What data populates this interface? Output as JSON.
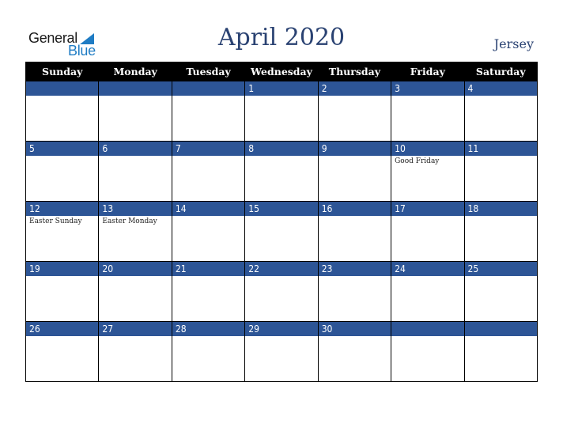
{
  "logo": {
    "general": "General",
    "blue": "Blue"
  },
  "header": {
    "title": "April 2020",
    "region": "Jersey"
  },
  "colors": {
    "accent": "#2d5596",
    "header_bg": "#000000",
    "title": "#2a4272",
    "logo_blue": "#1f7cc4"
  },
  "weekdays": [
    "Sunday",
    "Monday",
    "Tuesday",
    "Wednesday",
    "Thursday",
    "Friday",
    "Saturday"
  ],
  "weeks": [
    [
      {
        "day": "",
        "event": ""
      },
      {
        "day": "",
        "event": ""
      },
      {
        "day": "",
        "event": ""
      },
      {
        "day": "1",
        "event": ""
      },
      {
        "day": "2",
        "event": ""
      },
      {
        "day": "3",
        "event": ""
      },
      {
        "day": "4",
        "event": ""
      }
    ],
    [
      {
        "day": "5",
        "event": ""
      },
      {
        "day": "6",
        "event": ""
      },
      {
        "day": "7",
        "event": ""
      },
      {
        "day": "8",
        "event": ""
      },
      {
        "day": "9",
        "event": ""
      },
      {
        "day": "10",
        "event": "Good Friday"
      },
      {
        "day": "11",
        "event": ""
      }
    ],
    [
      {
        "day": "12",
        "event": "Easter Sunday"
      },
      {
        "day": "13",
        "event": "Easter Monday"
      },
      {
        "day": "14",
        "event": ""
      },
      {
        "day": "15",
        "event": ""
      },
      {
        "day": "16",
        "event": ""
      },
      {
        "day": "17",
        "event": ""
      },
      {
        "day": "18",
        "event": ""
      }
    ],
    [
      {
        "day": "19",
        "event": ""
      },
      {
        "day": "20",
        "event": ""
      },
      {
        "day": "21",
        "event": ""
      },
      {
        "day": "22",
        "event": ""
      },
      {
        "day": "23",
        "event": ""
      },
      {
        "day": "24",
        "event": ""
      },
      {
        "day": "25",
        "event": ""
      }
    ],
    [
      {
        "day": "26",
        "event": ""
      },
      {
        "day": "27",
        "event": ""
      },
      {
        "day": "28",
        "event": ""
      },
      {
        "day": "29",
        "event": ""
      },
      {
        "day": "30",
        "event": ""
      },
      {
        "day": "",
        "event": ""
      },
      {
        "day": "",
        "event": ""
      }
    ]
  ]
}
